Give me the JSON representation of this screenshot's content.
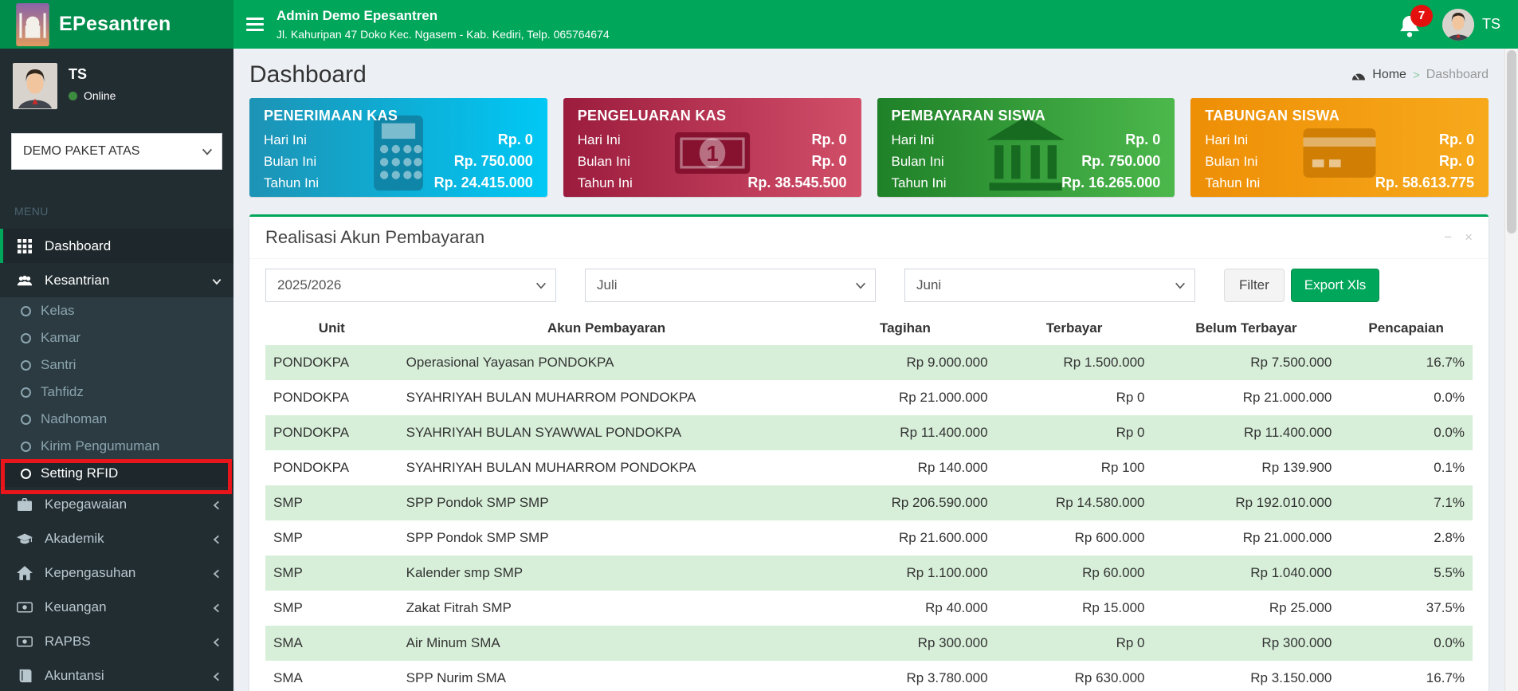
{
  "brand": {
    "name": "EPesantren",
    "logo_icon": "mosque-logo-icon"
  },
  "header": {
    "title": "Admin Demo Epesantren",
    "subtitle": "Jl. Kahuripan 47 Doko Kec. Ngasem - Kab. Kediri, Telp. 065764674",
    "notification_count": "7",
    "user_label": "TS"
  },
  "sidebar": {
    "user": {
      "name": "TS",
      "status": "Online"
    },
    "package_select": {
      "value": "DEMO PAKET ATAS"
    },
    "menu_label": "MENU",
    "highlighted_item": "Setting RFID",
    "items": [
      {
        "label": "Dashboard",
        "icon": "grid-icon",
        "active": true
      },
      {
        "label": "Kesantrian",
        "icon": "users-icon",
        "expanded": true,
        "children": [
          "Kelas",
          "Kamar",
          "Santri",
          "Tahfidz",
          "Nadhoman",
          "Kirim Pengumuman",
          "Setting RFID"
        ]
      },
      {
        "label": "Kepegawaian",
        "icon": "briefcase-icon"
      },
      {
        "label": "Akademik",
        "icon": "graduation-cap-icon"
      },
      {
        "label": "Kepengasuhan",
        "icon": "home-icon"
      },
      {
        "label": "Keuangan",
        "icon": "money-icon"
      },
      {
        "label": "RAPBS",
        "icon": "money-icon"
      },
      {
        "label": "Akuntansi",
        "icon": "book-icon"
      }
    ]
  },
  "page": {
    "title": "Dashboard",
    "breadcrumb": {
      "home": "Home",
      "separator": ">",
      "current": "Dashboard"
    }
  },
  "stat_cards": [
    {
      "title": "PENERIMAAN KAS",
      "icon": "calculator-icon",
      "color_from": "#1d93b5",
      "color_to": "#00c8f5",
      "icon_color": "#0f85a8",
      "rows": [
        {
          "label": "Hari Ini",
          "value": "Rp. 0"
        },
        {
          "label": "Bulan Ini",
          "value": "Rp. 750.000"
        },
        {
          "label": "Tahun Ini",
          "value": "Rp. 24.415.000"
        }
      ]
    },
    {
      "title": "PENGELUARAN KAS",
      "icon": "money-bill-icon",
      "color_from": "#9c1c3e",
      "color_to": "#d24f69",
      "icon_color": "#871230",
      "rows": [
        {
          "label": "Hari Ini",
          "value": "Rp. 0"
        },
        {
          "label": "Bulan Ini",
          "value": "Rp. 0"
        },
        {
          "label": "Tahun Ini",
          "value": "Rp. 38.545.500"
        }
      ]
    },
    {
      "title": "PEMBAYARAN SISWA",
      "icon": "bank-icon",
      "color_from": "#1f8128",
      "color_to": "#4cb84c",
      "icon_color": "#176b20",
      "rows": [
        {
          "label": "Hari Ini",
          "value": "Rp. 0"
        },
        {
          "label": "Bulan Ini",
          "value": "Rp. 750.000"
        },
        {
          "label": "Tahun Ini",
          "value": "Rp. 16.265.000"
        }
      ]
    },
    {
      "title": "TABUNGAN SISWA",
      "icon": "credit-card-icon",
      "color_from": "#ee8f06",
      "color_to": "#f7a91c",
      "icon_color": "#d07f04",
      "rows": [
        {
          "label": "Hari Ini",
          "value": "Rp. 0"
        },
        {
          "label": "Bulan Ini",
          "value": "Rp. 0"
        },
        {
          "label": "Tahun Ini",
          "value": "Rp. 58.613.775"
        }
      ]
    }
  ],
  "panel": {
    "title": "Realisasi Akun Pembayaran",
    "tools": [
      "minimize-icon",
      "close-icon"
    ],
    "filters": {
      "year": "2025/2026",
      "month_from": "Juli",
      "month_to": "Juni"
    },
    "buttons": {
      "filter": "Filter",
      "export": "Export Xls"
    },
    "table": {
      "columns": [
        "Unit",
        "Akun Pembayaran",
        "Tagihan",
        "Terbayar",
        "Belum Terbayar",
        "Pencapaian"
      ],
      "rows": [
        [
          "PONDOKPA",
          "Operasional Yayasan PONDOKPA",
          "Rp 9.000.000",
          "Rp 1.500.000",
          "Rp 7.500.000",
          "16.7%"
        ],
        [
          "PONDOKPA",
          "SYAHRIYAH BULAN MUHARROM PONDOKPA",
          "Rp 21.000.000",
          "Rp 0",
          "Rp 21.000.000",
          "0.0%"
        ],
        [
          "PONDOKPA",
          "SYAHRIYAH BULAN SYAWWAL PONDOKPA",
          "Rp 11.400.000",
          "Rp 0",
          "Rp 11.400.000",
          "0.0%"
        ],
        [
          "PONDOKPA",
          "SYAHRIYAH BULAN MUHARROM PONDOKPA",
          "Rp 140.000",
          "Rp 100",
          "Rp 139.900",
          "0.1%"
        ],
        [
          "SMP",
          "SPP Pondok SMP SMP",
          "Rp 206.590.000",
          "Rp 14.580.000",
          "Rp 192.010.000",
          "7.1%"
        ],
        [
          "SMP",
          "SPP Pondok SMP SMP",
          "Rp 21.600.000",
          "Rp 600.000",
          "Rp 21.000.000",
          "2.8%"
        ],
        [
          "SMP",
          "Kalender smp SMP",
          "Rp 1.100.000",
          "Rp 60.000",
          "Rp 1.040.000",
          "5.5%"
        ],
        [
          "SMP",
          "Zakat Fitrah SMP",
          "Rp 40.000",
          "Rp 15.000",
          "Rp 25.000",
          "37.5%"
        ],
        [
          "SMA",
          "Air Minum SMA",
          "Rp 300.000",
          "Rp 0",
          "Rp 300.000",
          "0.0%"
        ],
        [
          "SMA",
          "SPP Nurim SMA",
          "Rp 3.780.000",
          "Rp 630.000",
          "Rp 3.150.000",
          "16.7%"
        ]
      ]
    }
  },
  "colors": {
    "header_green": "#00a65a",
    "logo_green": "#008d4c",
    "sidebar_dark": "#222d32",
    "submenu_dark": "#2c3b41",
    "content_bg": "#ecf0f5",
    "stripe_green": "#d7efd9",
    "badge_red": "#e4100e",
    "annotation_red": "#e8151a",
    "online_green": "#3d8b40"
  }
}
